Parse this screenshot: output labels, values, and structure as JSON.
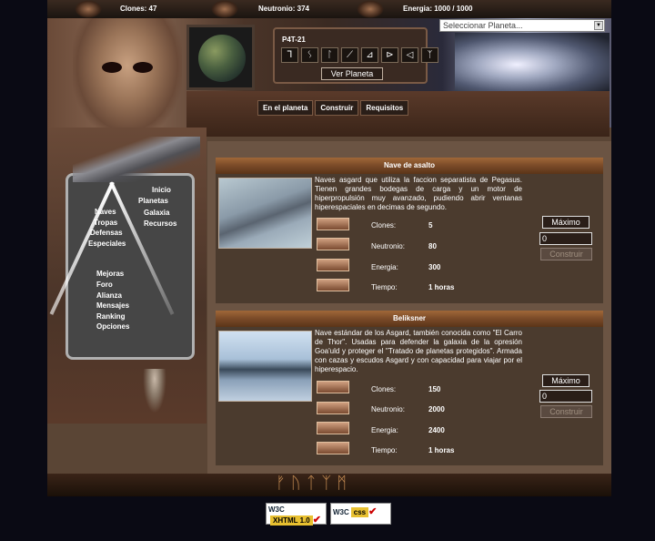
{
  "topbar": {
    "clones": "Clones: 47",
    "neutronio": "Neutronio: 374",
    "energia": "Energia: 1000 / 1000"
  },
  "planet": {
    "name": "P4T-21",
    "glyphs": [
      "⅂",
      "ᛊ",
      "ᛚ",
      "⟋",
      "⊿",
      "⊳",
      "◁",
      "ᛉ"
    ],
    "view_button": "Ver Planeta",
    "select_placeholder": "Seleccionar Planeta..."
  },
  "tabs": [
    "En el planeta",
    "Construir",
    "Requisitos"
  ],
  "nav": {
    "inicio": "Inicio",
    "planetas": "Planetas",
    "naves": "Naves",
    "galaxia": "Galaxia",
    "tropas": "Tropas",
    "recursos": "Recursos",
    "defensas": "Defensas",
    "especiales": "Especiales",
    "mejoras": "Mejoras",
    "foro": "Foro",
    "alianza": "Alianza",
    "mensajes": "Mensajes",
    "ranking": "Ranking",
    "opciones": "Opciones"
  },
  "ships": [
    {
      "title": "Nave de asalto",
      "description": "Naves asgard que utiliza la faccion separatista de Pegasus. Tienen grandes bodegas de carga y un motor de hiperpropulsión muy avanzado, pudiendo abrir ventanas hiperespaciales en decimas de segundo.",
      "clones_label": "Clones:",
      "clones": "5",
      "neutronio_label": "Neutronio:",
      "neutronio": "80",
      "energia_label": "Energia:",
      "energia": "300",
      "tiempo_label": "Tiempo:",
      "tiempo": "1 horas",
      "max_label": "Máximo",
      "qty": "0",
      "build_label": "Construir"
    },
    {
      "title": "Beliksner",
      "description": "Nave estándar de los Asgard, también conocida como \"El Carro de Thor\". Usadas para defender la galaxia de la opresión Goa'uld y proteger el \"Tratado de planetas protegidos\". Armada con cazas y escudos Asgard y con capacidad para viajar por el hiperespacio.",
      "clones_label": "Clones:",
      "clones": "150",
      "neutronio_label": "Neutronio:",
      "neutronio": "2000",
      "energia_label": "Energia:",
      "energia": "2400",
      "tiempo_label": "Tiempo:",
      "tiempo": "1 horas",
      "max_label": "Máximo",
      "qty": "0",
      "build_label": "Construir"
    }
  ],
  "footer": {
    "runes": "ᚠᚢᛏᛉᛗ",
    "w3c": "W3C",
    "xhtml_badge": "XHTML 1.0",
    "css_badge": "css"
  },
  "colors": {
    "panel_brown": "#4b3b2e",
    "content_brown": "#6b5443",
    "header_orange": "#a06838"
  }
}
